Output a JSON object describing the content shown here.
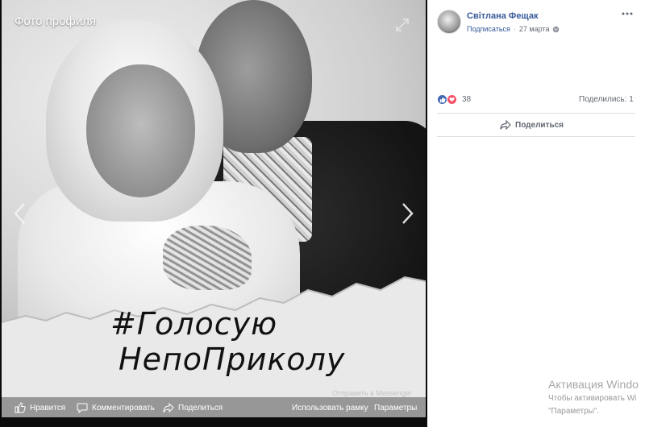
{
  "viewer": {
    "title": "Фото профиля",
    "hashtag_line1": "#Голосую",
    "hashtag_line2": "НепоПриколу",
    "send_messenger": "Отправить в Messenger",
    "actions": {
      "like": "Нравится",
      "comment": "Комментировать",
      "share": "Поделиться",
      "frame": "Использовать рамку",
      "options": "Параметры"
    }
  },
  "post": {
    "author": "Світлана Фещак",
    "follow": "Подписаться",
    "separator": "·",
    "date": "27 марта",
    "reaction_count": "38",
    "shares": "Поделились: 1",
    "share_button": "Поделиться"
  },
  "activation": {
    "title": "Активация Windo",
    "line1": "Чтобы активировать Wi",
    "line2": "\"Параметры\"."
  },
  "colors": {
    "link": "#365899",
    "like": "#4267b2",
    "love": "#f25268",
    "viewer_bg": "#0b0b0b"
  },
  "icons": {
    "expand": "expand-icon",
    "prev": "chevron-left-icon",
    "next": "chevron-right-icon",
    "more": "more-icon",
    "globe": "globe-icon",
    "like": "thumb-up-icon",
    "comment": "comment-icon",
    "share": "share-arrow-icon"
  }
}
